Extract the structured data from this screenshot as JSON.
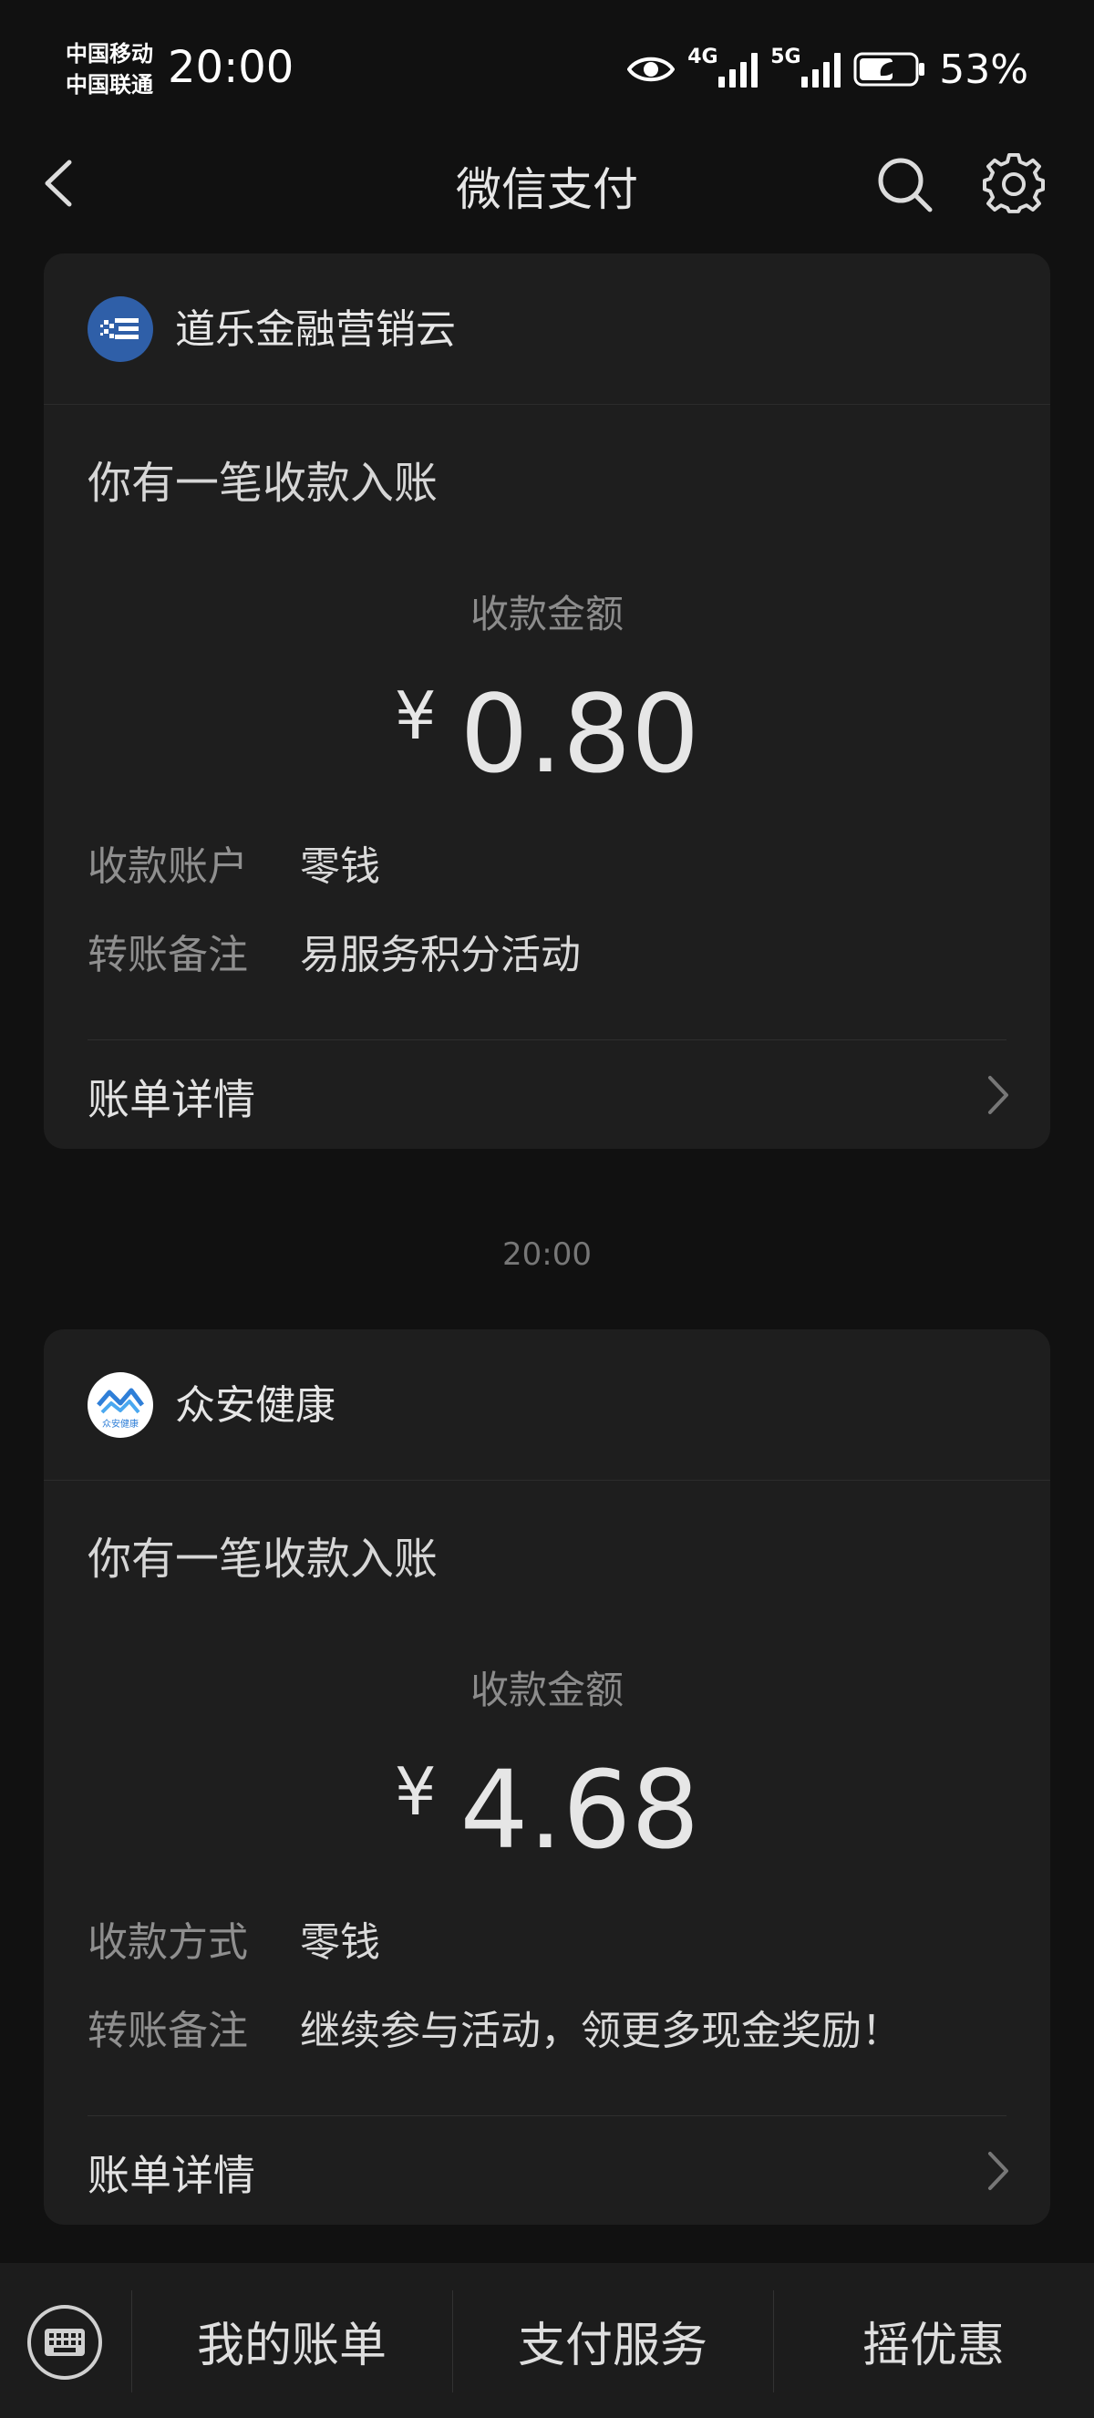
{
  "status_bar": {
    "carrier_1": "中国移动",
    "carrier_2": "中国联通",
    "time": "20:00",
    "network_1": "4G",
    "network_2": "5G",
    "battery": "53%"
  },
  "nav": {
    "title": "微信支付"
  },
  "messages": [
    {
      "merchant": "道乐金融营销云",
      "title": "你有一笔收款入账",
      "amount_label": "收款金额",
      "currency": "¥",
      "amount": "0.80",
      "rows": [
        {
          "label": "收款账户",
          "value": "零钱"
        },
        {
          "label": "转账备注",
          "value": "易服务积分活动"
        }
      ],
      "detail_label": "账单详情"
    },
    {
      "merchant": "众安健康",
      "logo_text": "众安健康",
      "title": "你有一笔收款入账",
      "amount_label": "收款金额",
      "currency": "¥",
      "amount": "4.68",
      "rows": [
        {
          "label": "收款方式",
          "value": "零钱"
        },
        {
          "label": "转账备注",
          "value": "继续参与活动，领更多现金奖励！"
        }
      ],
      "detail_label": "账单详情"
    }
  ],
  "timestamp": "20:00",
  "bottom_menu": {
    "item_1": "我的账单",
    "item_2": "支付服务",
    "item_3": "摇优惠"
  },
  "colors": {
    "background": "#111111",
    "card": "#1e1e1e",
    "logo_blue": "#2f5fa8"
  }
}
